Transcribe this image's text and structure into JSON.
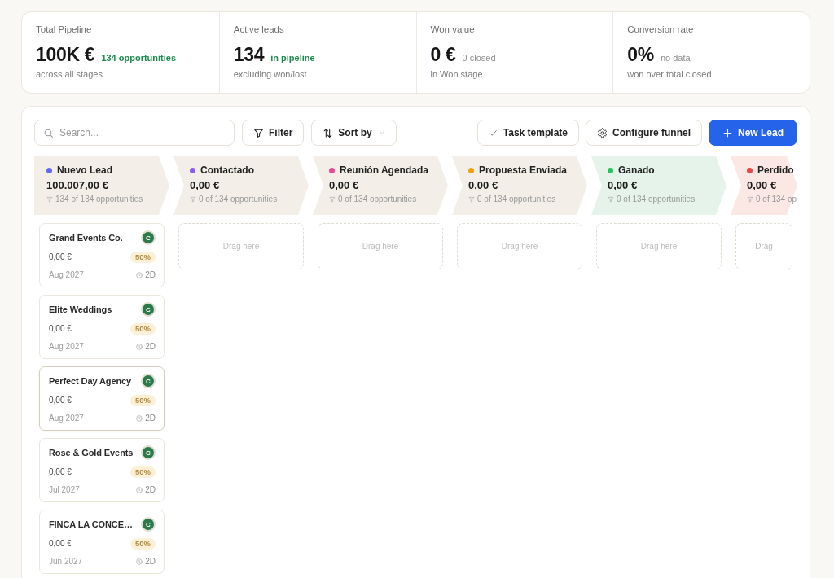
{
  "summary": [
    {
      "label": "Total Pipeline",
      "value": "100K €",
      "note": {
        "text": "134 opportunities",
        "positive": true
      },
      "caption": "across all stages"
    },
    {
      "label": "Active leads",
      "value": "134",
      "note": {
        "text": "in pipeline",
        "positive": true
      },
      "caption": "excluding won/lost"
    },
    {
      "label": "Won value",
      "value": "0 €",
      "note": {
        "text": "0 closed",
        "positive": false
      },
      "caption": "in Won stage"
    },
    {
      "label": "Conversion rate",
      "value": "0%",
      "note": {
        "text": "no data",
        "positive": false
      },
      "caption": "won over total closed"
    }
  ],
  "toolbar": {
    "search": {
      "placeholder": "Search..."
    },
    "buttons": [
      {
        "label": "Filter",
        "kind": "filter",
        "dropdown": false
      },
      {
        "label": "Sort by",
        "kind": "sort",
        "dropdown": true
      }
    ],
    "actions": [
      {
        "label": "Task template",
        "kind": "task",
        "primary": false
      },
      {
        "label": "Configure funnel",
        "kind": "settings",
        "primary": false
      },
      {
        "label": "New Lead",
        "kind": "create",
        "primary": true
      }
    ]
  },
  "stages": [
    {
      "name": "Nuevo Lead",
      "color": "#6366f1",
      "kind": "open",
      "amount": "100.007,00 €",
      "count": "134 of 134 opportunities",
      "cards": [
        {
          "title": "Grand Events Co.",
          "avatar": "C",
          "amount": "0,00 €",
          "probability": "50%",
          "date": "Aug 2027",
          "age": "2D",
          "hovered": false
        },
        {
          "title": "Elite Weddings",
          "avatar": "C",
          "amount": "0,00 €",
          "probability": "50%",
          "date": "Aug 2027",
          "age": "2D",
          "hovered": false
        },
        {
          "title": "Perfect Day Agency",
          "avatar": "C",
          "amount": "0,00 €",
          "probability": "50%",
          "date": "Aug 2027",
          "age": "2D",
          "hovered": true
        },
        {
          "title": "Rose & Gold Events",
          "avatar": "C",
          "amount": "0,00 €",
          "probability": "50%",
          "date": "Jul 2027",
          "age": "2D",
          "hovered": false
        },
        {
          "title": "FINCA LA CONCE…",
          "avatar": "C",
          "amount": "0,00 €",
          "probability": "50%",
          "date": "Jun 2027",
          "age": "2D",
          "hovered": false
        }
      ]
    },
    {
      "name": "Contactado",
      "color": "#8b5cf6",
      "kind": "open",
      "amount": "0,00 €",
      "count": "0 of 134 opportunities",
      "dropzone": "Drag here"
    },
    {
      "name": "Reunión Agendada",
      "color": "#ec4899",
      "kind": "open",
      "amount": "0,00 €",
      "count": "0 of 134 opportunities",
      "dropzone": "Drag here"
    },
    {
      "name": "Propuesta Enviada",
      "color": "#f59e0b",
      "kind": "open",
      "amount": "0,00 €",
      "count": "0 of 134 opportunities",
      "dropzone": "Drag here"
    },
    {
      "name": "Ganado",
      "color": "#22c55e",
      "kind": "won",
      "amount": "0,00 €",
      "count": "0 of 134 opportunities",
      "dropzone": "Drag here"
    },
    {
      "name": "Perdido",
      "color": "#ef4444",
      "kind": "lost",
      "amount": "0,00 €",
      "count": "0 of 134 op",
      "dropzone": "Drag"
    }
  ]
}
